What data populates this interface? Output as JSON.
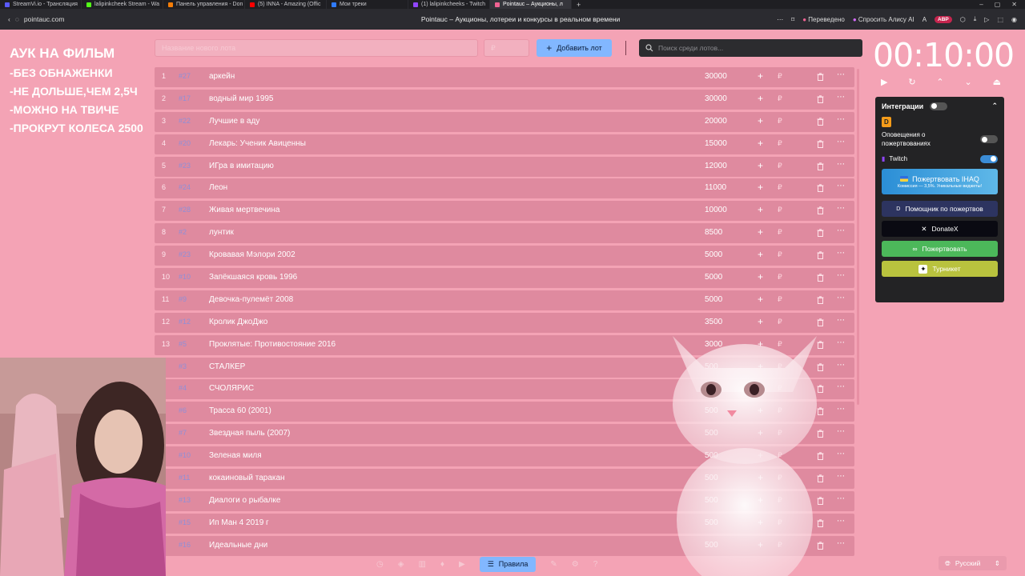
{
  "browser": {
    "tabs": [
      {
        "label": "StreamVi.io - Трансляция",
        "color": "#5a5aff"
      },
      {
        "label": "lalipinkcheek Stream - Wa",
        "color": "#53fc18"
      },
      {
        "label": "Панель управления - Don",
        "color": "#f57d07"
      },
      {
        "label": "(5) INNA - Amazing (Offic",
        "color": "#ff0000"
      },
      {
        "label": "Мои треки",
        "color": "#2f7bff"
      },
      {
        "label": "(1) lalipinkcheeks - Twitch",
        "color": "#9146ff"
      },
      {
        "label": "Pointauc – Аукционы, л",
        "color": "#f06292"
      }
    ],
    "url": "pointauc.com",
    "page_title": "Pointauc – Аукционы, лотереи и конкурсы в реальном времени",
    "translated_label": "Переведено",
    "ask_alice_label": "Спросить Алису AI",
    "badge": "ABP"
  },
  "notes": {
    "title": "АУК НА ФИЛЬМ",
    "rules": [
      "-БЕЗ ОБНАЖЕНКИ",
      "-НЕ ДОЛЬШЕ,ЧЕМ 2,5Ч",
      "-МОЖНО НА ТВИЧЕ",
      "-ПРОКРУТ КОЛЕСА 2500"
    ]
  },
  "controls": {
    "lot_name_placeholder": "Название нового лота",
    "amount_placeholder": "₽",
    "add_lot_label": "Добавить лот",
    "search_placeholder": "Поиск среди лотов..."
  },
  "lots": [
    {
      "num": "1",
      "id": "#27",
      "name": "аркейн",
      "amount": "30000"
    },
    {
      "num": "2",
      "id": "#17",
      "name": "водный мир 1995",
      "amount": "30000"
    },
    {
      "num": "3",
      "id": "#22",
      "name": "Лучшие в аду",
      "amount": "20000"
    },
    {
      "num": "4",
      "id": "#20",
      "name": "Лекарь: Ученик Авиценны",
      "amount": "15000"
    },
    {
      "num": "5",
      "id": "#23",
      "name": "ИГра в имитацию",
      "amount": "12000"
    },
    {
      "num": "6",
      "id": "#24",
      "name": "Леон",
      "amount": "11000"
    },
    {
      "num": "7",
      "id": "#28",
      "name": "Живая мертвечина",
      "amount": "10000"
    },
    {
      "num": "8",
      "id": "#2",
      "name": "лунтик",
      "amount": "8500"
    },
    {
      "num": "9",
      "id": "#23",
      "name": "Кровавая Мэлори 2002",
      "amount": "5000"
    },
    {
      "num": "10",
      "id": "#10",
      "name": "Запёкшаяся кровь 1996",
      "amount": "5000"
    },
    {
      "num": "11",
      "id": "#9",
      "name": "Девочка-пулемёт 2008",
      "amount": "5000"
    },
    {
      "num": "12",
      "id": "#12",
      "name": "Кролик ДжоДжо",
      "amount": "3500"
    },
    {
      "num": "13",
      "id": "#5",
      "name": "Проклятые: Противостояние 2016",
      "amount": "3000"
    },
    {
      "num": "4",
      "id": "#3",
      "name": "СТАЛКЕР",
      "amount": "500"
    },
    {
      "num": "5",
      "id": "#4",
      "name": "СЧОЛЯРИС",
      "amount": "500"
    },
    {
      "num": "6",
      "id": "#6",
      "name": "Трасса 60 (2001)",
      "amount": "500"
    },
    {
      "num": "7",
      "id": "#7",
      "name": "Звездная пыль (2007)",
      "amount": "500"
    },
    {
      "num": "8",
      "id": "#10",
      "name": "Зеленая миля",
      "amount": "500"
    },
    {
      "num": "9",
      "id": "#11",
      "name": "кокаиновый таракан",
      "amount": "500"
    },
    {
      "num": "0",
      "id": "#13",
      "name": "Диалоги о рыбалке",
      "amount": "500"
    },
    {
      "num": "1",
      "id": "#15",
      "name": "Ип Ман 4 2019 г",
      "amount": "500"
    },
    {
      "num": "2",
      "id": "#16",
      "name": "Идеальные дни",
      "amount": "500"
    }
  ],
  "timer": {
    "display": "00:10:00"
  },
  "integrations": {
    "title": "Интеграции",
    "donation_alerts_label": "Оповещения о пожертвованиях",
    "twitch_label": "Twitch",
    "ihaq_label": "Пожертвовать IHAQ",
    "ihaq_sub": "Комиссия — 3,5%. Уникальные виджеты!",
    "helper_label": "Помощник по пожертвов",
    "donatex_label": "DonateX",
    "donate_label": "Пожертвовать",
    "turniket_label": "Турникет"
  },
  "bottom": {
    "rules_label": "Правила",
    "language": "Русский"
  }
}
